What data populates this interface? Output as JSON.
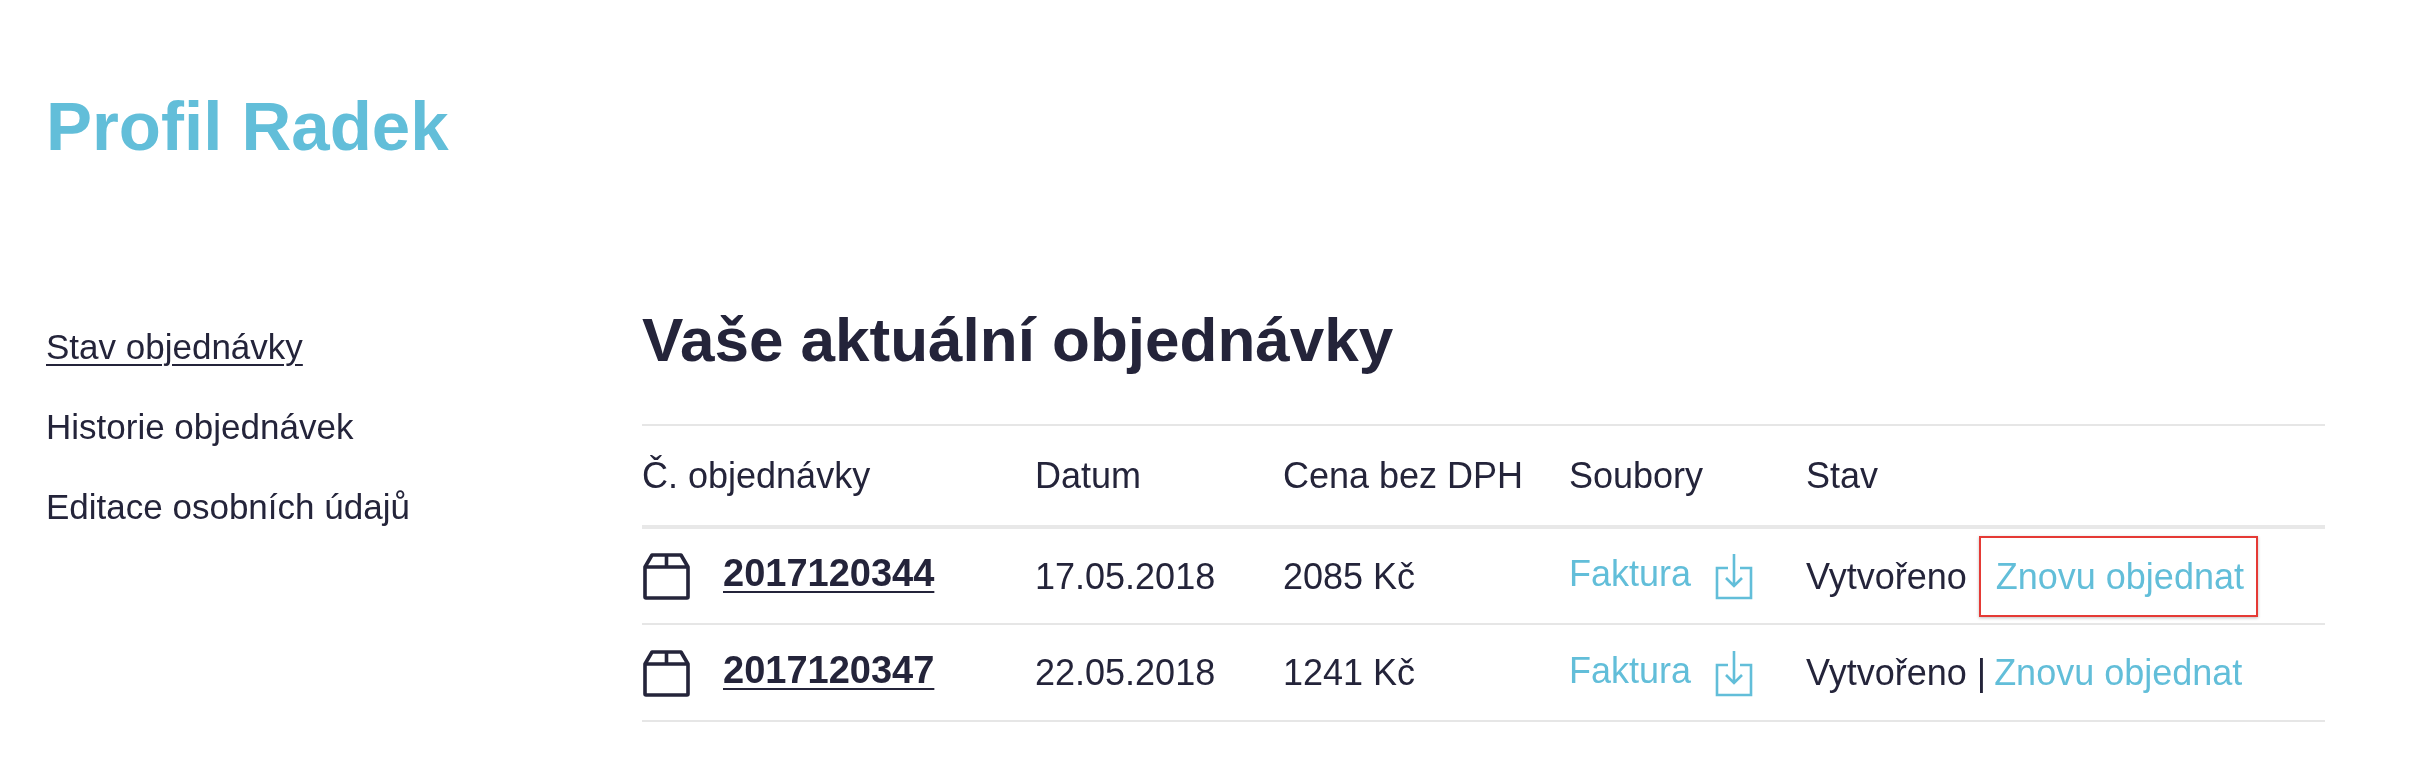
{
  "page": {
    "title": "Profil Radek"
  },
  "sidebar": {
    "items": [
      {
        "label": "Stav objednávky",
        "selected": true
      },
      {
        "label": "Historie objednávek",
        "selected": false
      },
      {
        "label": "Editace osobních údajů",
        "selected": false
      }
    ]
  },
  "orders": {
    "heading": "Vaše aktuální objednávky",
    "columns": [
      "Č. objednávky",
      "Datum",
      "Cena bez DPH",
      "Soubory",
      "Stav"
    ],
    "rows": [
      {
        "order_number": "2017120344",
        "date": "17.05.2018",
        "price": "2085 Kč",
        "file": "Faktura",
        "status": "Vytvořeno",
        "action": "Znovu objednat",
        "highlighted": true
      },
      {
        "order_number": "2017120347",
        "date": "22.05.2018",
        "price": "1241 Kč",
        "file": "Faktura",
        "status": "Vytvořeno",
        "separator": "|",
        "action": "Znovu objednat",
        "highlighted": false
      }
    ]
  }
}
